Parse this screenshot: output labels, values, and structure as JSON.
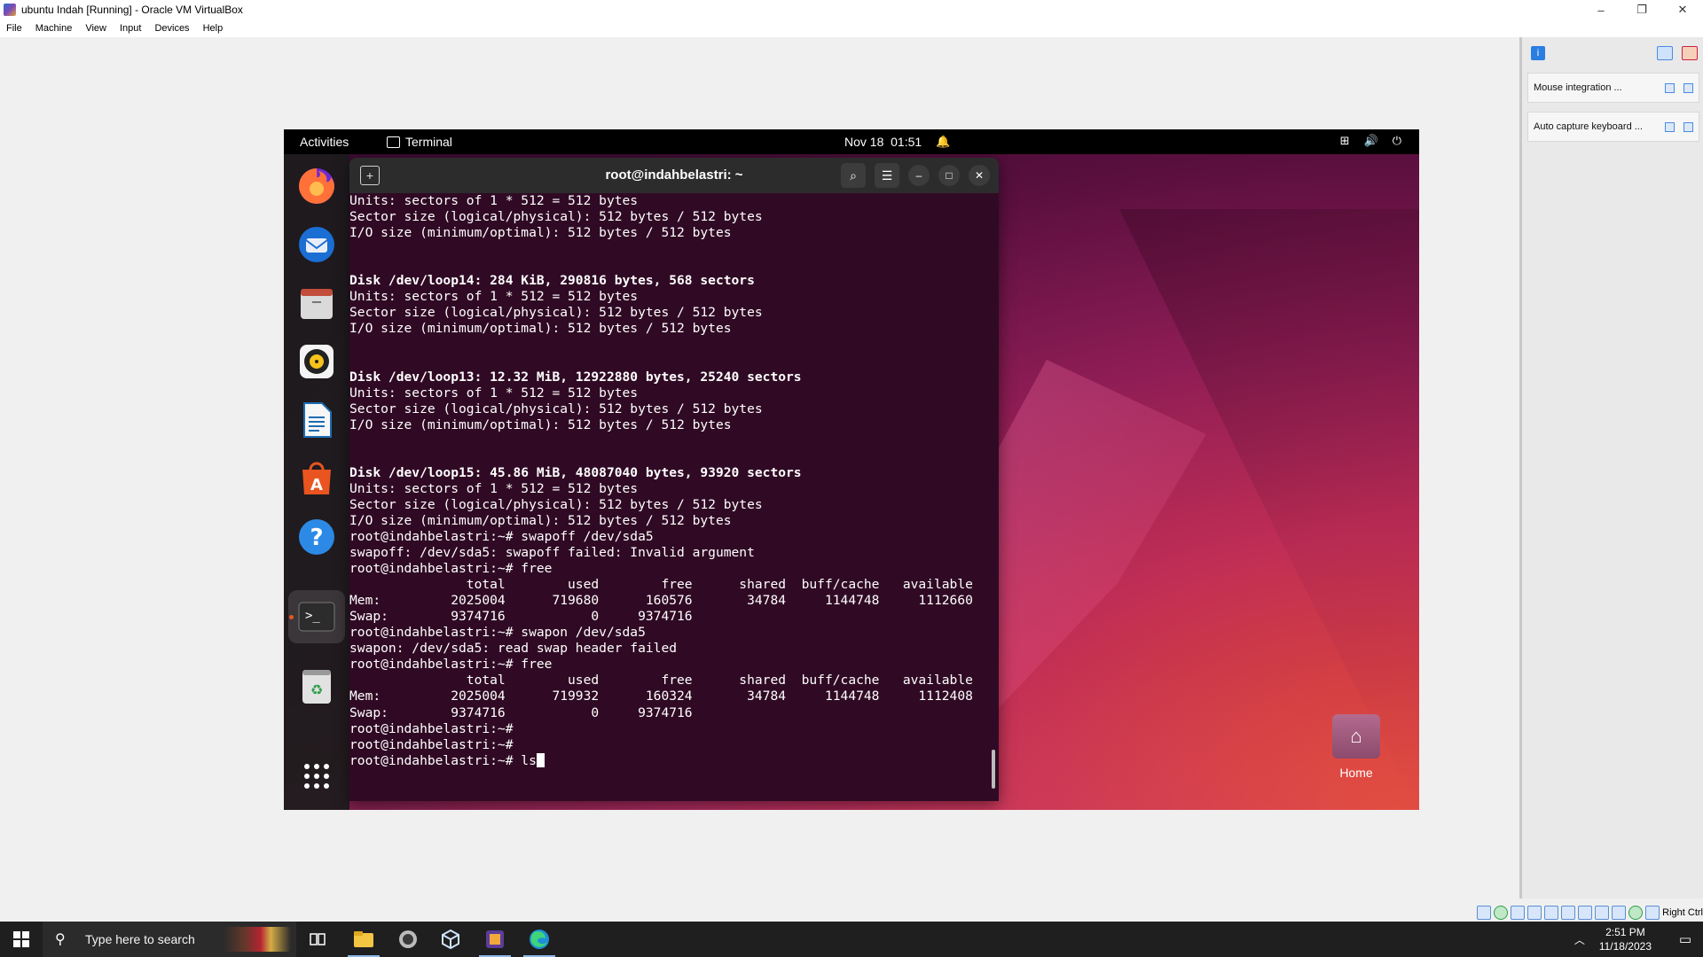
{
  "window": {
    "title": "ubuntu Indah [Running] - Oracle VM VirtualBox",
    "controls": {
      "minimize": "–",
      "restore": "❐",
      "close": "✕"
    }
  },
  "menu": [
    "File",
    "Machine",
    "View",
    "Input",
    "Devices",
    "Help"
  ],
  "notifications": [
    {
      "label": "Mouse integration ..."
    },
    {
      "label": "Auto capture keyboard ..."
    }
  ],
  "status_bar": {
    "host_key": "Right Ctrl"
  },
  "guest": {
    "topbar": {
      "activities": "Activities",
      "app": "Terminal",
      "clock": "Nov 18  01:51"
    },
    "desktop_home_label": "Home",
    "terminal": {
      "title": "root@indahbelastri: ~",
      "prompt": "root@indahbelastri:~#",
      "current_input": "ls",
      "lines": [
        "Units: sectors of 1 * 512 = 512 bytes",
        "Sector size (logical/physical): 512 bytes / 512 bytes",
        "I/O size (minimum/optimal): 512 bytes / 512 bytes",
        "",
        "",
        "Disk /dev/loop14: 284 KiB, 290816 bytes, 568 sectors",
        "Units: sectors of 1 * 512 = 512 bytes",
        "Sector size (logical/physical): 512 bytes / 512 bytes",
        "I/O size (minimum/optimal): 512 bytes / 512 bytes",
        "",
        "",
        "Disk /dev/loop13: 12.32 MiB, 12922880 bytes, 25240 sectors",
        "Units: sectors of 1 * 512 = 512 bytes",
        "Sector size (logical/physical): 512 bytes / 512 bytes",
        "I/O size (minimum/optimal): 512 bytes / 512 bytes",
        "",
        "",
        "Disk /dev/loop15: 45.86 MiB, 48087040 bytes, 93920 sectors",
        "Units: sectors of 1 * 512 = 512 bytes",
        "Sector size (logical/physical): 512 bytes / 512 bytes",
        "I/O size (minimum/optimal): 512 bytes / 512 bytes",
        "root@indahbelastri:~# swapoff /dev/sda5",
        "swapoff: /dev/sda5: swapoff failed: Invalid argument",
        "root@indahbelastri:~# free",
        "               total        used        free      shared  buff/cache   available",
        "Mem:         2025004      719680      160576       34784     1144748     1112660",
        "Swap:        9374716           0     9374716",
        "root@indahbelastri:~# swapon /dev/sda5",
        "swapon: /dev/sda5: read swap header failed",
        "root@indahbelastri:~# free",
        "               total        used        free      shared  buff/cache   available",
        "Mem:         2025004      719932      160324       34784     1144748     1112408",
        "Swap:        9374716           0     9374716",
        "root@indahbelastri:~#",
        "root@indahbelastri:~#"
      ],
      "bold_line_indices": [
        5,
        11,
        17
      ]
    },
    "dock": [
      "firefox-icon",
      "thunderbird-icon",
      "files-icon",
      "rhythmbox-icon",
      "libreoffice-writer-icon",
      "app-center-icon",
      "help-icon",
      "terminal-icon",
      "trash-icon",
      "show-apps-icon"
    ]
  },
  "taskbar": {
    "search_placeholder": "Type here to search",
    "time": "2:51 PM",
    "date": "11/18/2023"
  }
}
